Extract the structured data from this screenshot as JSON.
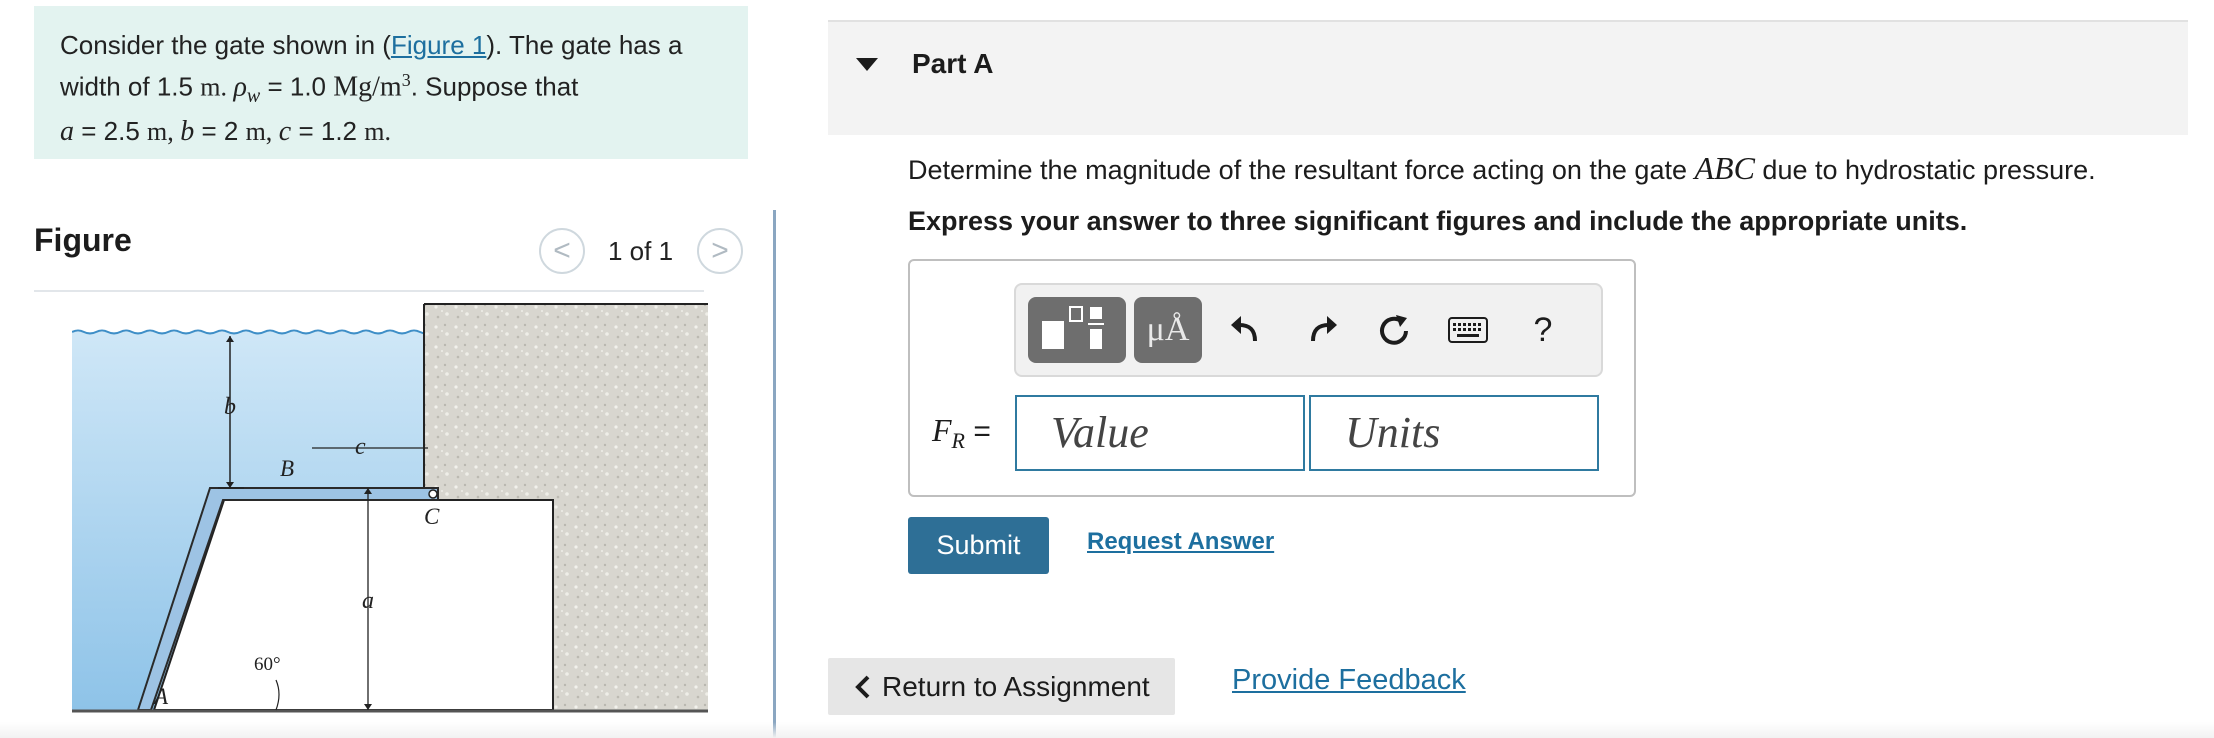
{
  "problem": {
    "text1": "Consider the gate shown in (",
    "figure_link": "Figure 1",
    "text2": "). The gate has a",
    "line2a": "width of 1.5 ",
    "unit_m": "m",
    "line2b": ". ",
    "rho": "ρ",
    "rho_sub": "w",
    "line2c": " = 1.0 ",
    "rho_unit": "Mg/m",
    "rho_exp": "3",
    "line2d": ". Suppose that",
    "a_var": "a",
    "a_val": " = 2.5 ",
    "b_var": "b",
    "b_val": " = 2 ",
    "c_var": "c",
    "c_val": " = 1.2 ",
    "sep": ", ",
    "end": "."
  },
  "figure": {
    "title": "Figure",
    "pager": "1 of 1",
    "prev_glyph": "<",
    "next_glyph": ">",
    "labels": {
      "b": "b",
      "c": "c",
      "B": "B",
      "C": "C",
      "a": "a",
      "A": "A",
      "angle": "60°"
    }
  },
  "part": {
    "title": "Part A",
    "question_pre": "Determine the magnitude of the resultant force acting on the gate ",
    "question_var": "ABC",
    "question_post": " due to hydrostatic pressure.",
    "instruction": "Express your answer to three significant figures and include the appropriate units."
  },
  "toolbar": {
    "units_glyph": "μÅ",
    "help_glyph": "?",
    "icons": [
      "templates-icon",
      "units-icon",
      "undo-icon",
      "redo-icon",
      "reset-icon",
      "keyboard-icon",
      "help-icon"
    ]
  },
  "answer": {
    "label_var": "F",
    "label_sub": "R",
    "label_eq": " =",
    "value_placeholder": "Value",
    "units_placeholder": "Units"
  },
  "actions": {
    "submit": "Submit",
    "request": "Request Answer",
    "return": "Return to Assignment",
    "feedback": "Provide Feedback"
  },
  "colors": {
    "accent": "#2e6f96",
    "link": "#1d6f9f",
    "problem_bg": "#e3f3f0",
    "water": "#a9d2ee"
  }
}
